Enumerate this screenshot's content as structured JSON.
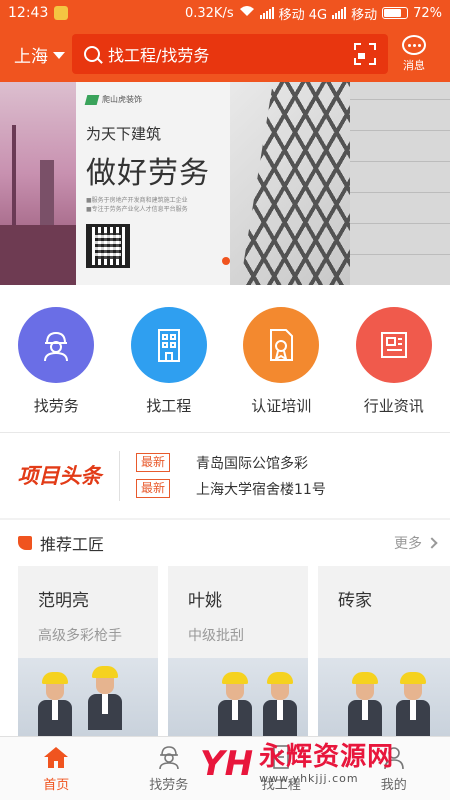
{
  "status": {
    "time": "12:43",
    "speed": "0.32K/s",
    "carrier1": "移动 4G",
    "carrier2": "移动",
    "battery": "72%",
    "battery_level": 0.72
  },
  "header": {
    "city": "上海",
    "search_placeholder": "找工程/找劳务",
    "message_label": "消息"
  },
  "banner": {
    "brand": "爬山虎装饰",
    "slogan": "为天下建筑",
    "title": "做好劳务",
    "sub_line1": "■服务于房地产开发商和建筑施工企业",
    "sub_line2": "■专注于劳务产业化人才信息平台服务"
  },
  "quick_links": [
    {
      "label": "找劳务",
      "icon": "worker-icon",
      "color": "#6a6ee6"
    },
    {
      "label": "找工程",
      "icon": "building-icon",
      "color": "#2f9ff0"
    },
    {
      "label": "认证培训",
      "icon": "certificate-icon",
      "color": "#f3892f"
    },
    {
      "label": "行业资讯",
      "icon": "newspaper-icon",
      "color": "#f05a4c"
    }
  ],
  "headlines": {
    "logo": "项目头条",
    "items": [
      {
        "tag": "最新",
        "text": "青岛国际公馆多彩"
      },
      {
        "tag": "最新",
        "text": "上海大学宿舍楼11号"
      }
    ]
  },
  "recommend": {
    "title": "推荐工匠",
    "more": "更多",
    "cards": [
      {
        "name": "范明亮",
        "skill": "高级多彩枪手"
      },
      {
        "name": "叶姚",
        "skill": "中级批刮"
      },
      {
        "name": "砖家",
        "skill": ""
      }
    ]
  },
  "tabs": [
    {
      "label": "首页",
      "icon": "home-icon",
      "active": true
    },
    {
      "label": "找劳务",
      "icon": "worker-icon",
      "active": false
    },
    {
      "label": "找工程",
      "icon": "building-icon",
      "active": false
    },
    {
      "label": "我的",
      "icon": "person-icon",
      "active": false
    }
  ],
  "watermark": {
    "logo": "YH",
    "name": "永辉资源网",
    "url": "www.yhkjjj.com"
  },
  "colors": {
    "brand": "#f0541f",
    "search_bg": "#e8360f",
    "headline_red": "#e23b17"
  }
}
